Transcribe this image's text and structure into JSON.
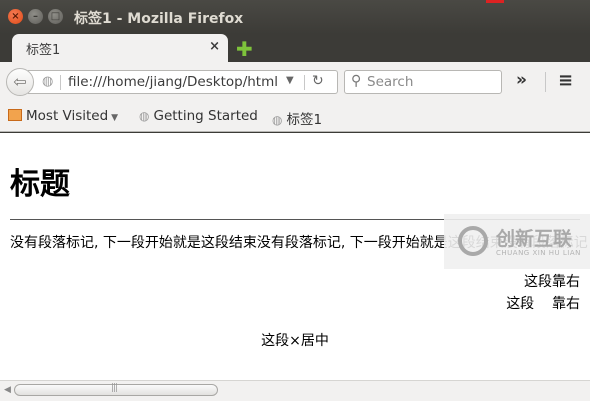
{
  "window": {
    "title": "标签1 - Mozilla Firefox",
    "close_glyph": "×",
    "min_glyph": "–",
    "max_glyph": "□"
  },
  "tab": {
    "label": "标签1",
    "close_glyph": "×",
    "new_tab_glyph": "✚"
  },
  "nav": {
    "back_glyph": "⇦",
    "url": "file:///home/jiang/Desktop/html",
    "url_dropdown_glyph": "▼",
    "reload_glyph": "↻",
    "search_placeholder": "Search",
    "overflow_glyph": "»",
    "menu_glyph": "≡"
  },
  "bookmarks": [
    {
      "label": "Most Visited",
      "arrow": "▼"
    },
    {
      "label": "Getting Started"
    },
    {
      "label": "标签1"
    }
  ],
  "page": {
    "heading": "标题",
    "paragraph": "没有段落标记, 下一段开始就是这段结束没有段落标记, 下一段开始就是这段结束没有段落标记",
    "right_aligned_1": "这段靠右",
    "right_aligned_2": "这段    靠右",
    "centered": "这段×居中"
  },
  "watermark": {
    "text": "创新互联",
    "sub": "CHUANG XIN HU LIAN"
  },
  "scrollbar": {
    "left_arrow": "◀",
    "grip": "|||"
  }
}
